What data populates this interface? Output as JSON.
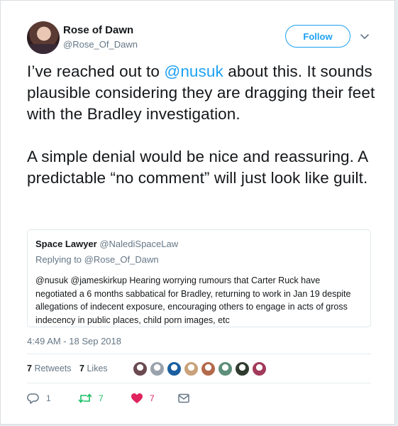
{
  "author": {
    "display_name": "Rose of Dawn",
    "handle": "@Rose_Of_Dawn"
  },
  "follow_label": "Follow",
  "tweet": {
    "para1_pre": "I’ve reached out to ",
    "para1_mention": "@nusuk",
    "para1_post": " about this. It sounds plausible considering they are dragging their feet with the Bradley investigation.",
    "para2": "A simple denial would be nice and reassuring. A predictable “no comment” will just look like guilt."
  },
  "quote": {
    "display_name": "Space Lawyer",
    "handle": "@NalediSpaceLaw",
    "replying_to": "Replying to @Rose_Of_Dawn",
    "body": "@nusuk @jameskirkup Hearing worrying rumours that Carter Ruck have negotiated a 6 months sabbatical for Bradley, returning to work in Jan 19 despite allegations of indecent exposure, encouraging others to engage in acts of gross indecency in public places, child porn images, etc"
  },
  "timestamp": "4:49 AM - 18 Sep 2018",
  "stats": {
    "retweets_count": "7",
    "retweets_label": "Retweets",
    "likes_count": "7",
    "likes_label": "Likes"
  },
  "likers": [
    {
      "color": "#6b4a52"
    },
    {
      "color": "#9aa3ad"
    },
    {
      "color": "#1b5fa0"
    },
    {
      "color": "#c9a27a"
    },
    {
      "color": "#b46a4c"
    },
    {
      "color": "#5e8f7a"
    },
    {
      "color": "#2f3b2f"
    },
    {
      "color": "#a23a5a"
    }
  ],
  "actions": {
    "reply_count": "1",
    "retweet_count": "7",
    "like_count": "7"
  },
  "icons": {
    "caret": "chevron-down-icon",
    "reply": "reply-icon",
    "retweet": "retweet-icon",
    "like": "heart-icon",
    "dm": "envelope-icon"
  },
  "colors": {
    "accent": "#1da1f2",
    "retweet": "#17bf63",
    "like": "#e0245e",
    "secondary_text": "#657786"
  }
}
